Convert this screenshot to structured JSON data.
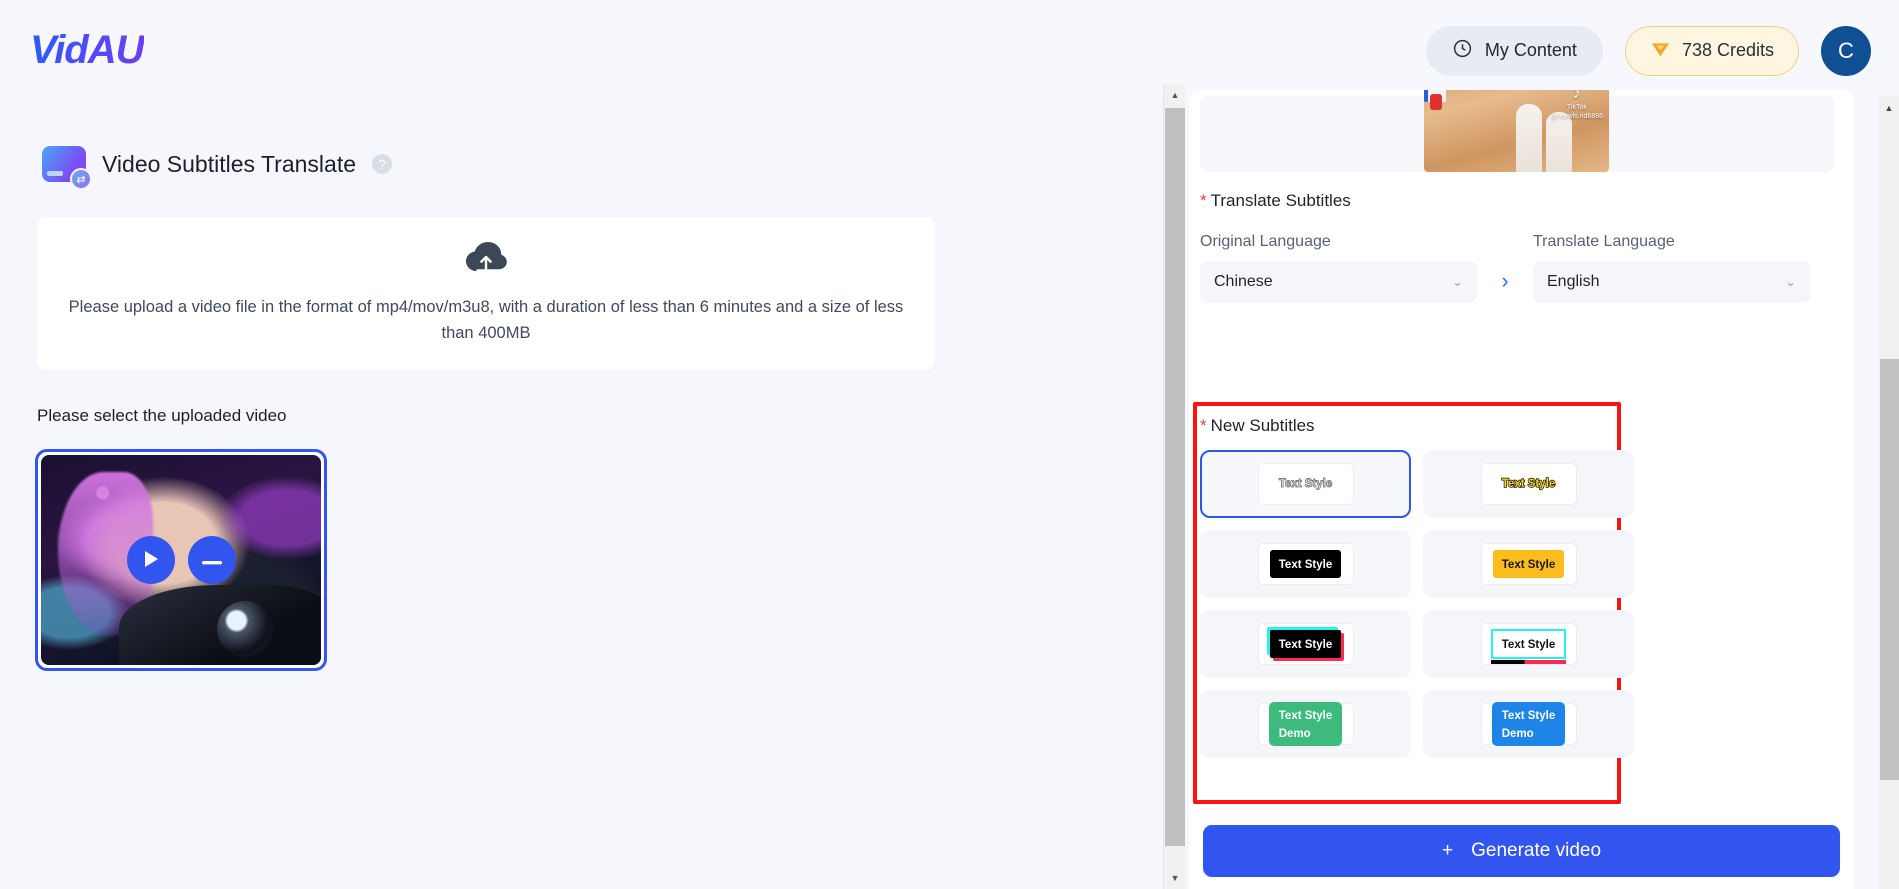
{
  "header": {
    "logo": "VidAU",
    "my_content": "My Content",
    "credits": "738 Credits",
    "avatar_initial": "C",
    "clock_icon": "clock-icon",
    "diamond_icon": "diamond-icon"
  },
  "main": {
    "page_title": "Video Subtitles Translate",
    "help_icon": "?",
    "upload_text": "Please upload a video file in the format of mp4/mov/m3u8, with a duration of less than 6 minutes and a size of less than 400MB",
    "select_video_label": "Please select the uploaded video",
    "play_icon": "play-icon",
    "remove_icon": "minus-icon"
  },
  "panel": {
    "translate_subtitles_label": "Translate Subtitles",
    "required_star": "*",
    "original_language_label": "Original Language",
    "original_language_value": "Chinese",
    "translate_language_label": "Translate Language",
    "translate_language_value": "English",
    "direction_arrow": "›",
    "chevron": "⌄",
    "new_subtitles_label": "New Subtitles",
    "styles": [
      {
        "label": "Text Style",
        "variant": "outline-white",
        "selected": true
      },
      {
        "label": "Text Style",
        "variant": "yellow-outline",
        "selected": false
      },
      {
        "label": "Text Style",
        "variant": "white-on-black",
        "selected": false
      },
      {
        "label": "Text Style",
        "variant": "black-on-yellow",
        "selected": false
      },
      {
        "label": "Text Style",
        "variant": "tiktok-black",
        "selected": false
      },
      {
        "label": "Text Style",
        "variant": "tiktok-white",
        "selected": false
      },
      {
        "label": "Text Style\nDemo",
        "variant": "green-box",
        "selected": false
      },
      {
        "label": "Text Style\nDemo",
        "variant": "blue-box",
        "selected": false
      }
    ],
    "video_thumb_watermark": "TikTok",
    "video_thumb_handle": "@ eowls.rid6886"
  },
  "generate": {
    "label": "Generate video",
    "plus_icon": "+"
  },
  "colors": {
    "accent_blue": "#3355ef",
    "annotation_red": "#fd1212",
    "credit_orange": "#fbbd1e",
    "required_red": "#e8403a"
  }
}
